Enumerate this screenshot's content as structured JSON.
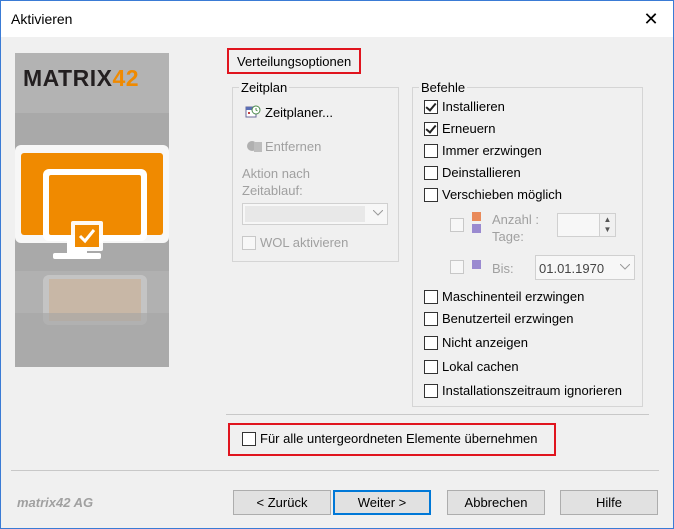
{
  "window": {
    "title": "Aktivieren",
    "close_glyph": "✕"
  },
  "brand": {
    "logo_text": "MATRIX",
    "logo_number": "42",
    "footer": "matrix42 AG",
    "accent": "#f08a00"
  },
  "distribution": {
    "heading": "Verteilungsoptionen",
    "schedule": {
      "title": "Zeitplan",
      "scheduler_label": "Zeitplaner...",
      "remove_label": "Entfernen",
      "action_label": "Aktion nach Zeitablauf:",
      "action_value": "",
      "wol_label": "WOL aktivieren"
    },
    "commands": {
      "title": "Befehle",
      "items": [
        {
          "label": "Installieren",
          "checked": true
        },
        {
          "label": "Erneuern",
          "checked": true
        },
        {
          "label": "Immer erzwingen",
          "checked": false
        },
        {
          "label": "Deinstallieren",
          "checked": false
        },
        {
          "label": "Verschieben möglich",
          "checked": false
        }
      ],
      "count_label": "Anzahl : Tage:",
      "count_value": "",
      "until_label": "Bis:",
      "until_value": "01.01.1970",
      "items2": [
        {
          "label": "Maschinenteil erzwingen",
          "checked": false
        },
        {
          "label": "Benutzerteil erzwingen",
          "checked": false
        },
        {
          "label": "Nicht anzeigen",
          "checked": false
        },
        {
          "label": "Lokal cachen",
          "checked": false
        },
        {
          "label": "Installationszeitraum ignorieren",
          "checked": false
        }
      ]
    },
    "apply_children_label": "Für alle untergeordneten Elemente übernehmen"
  },
  "buttons": {
    "back": "< Zurück",
    "next": "Weiter >",
    "cancel": "Abbrechen",
    "help": "Hilfe"
  },
  "colors": {
    "highlight": "#e0141e",
    "primary_border": "#0078d7"
  }
}
